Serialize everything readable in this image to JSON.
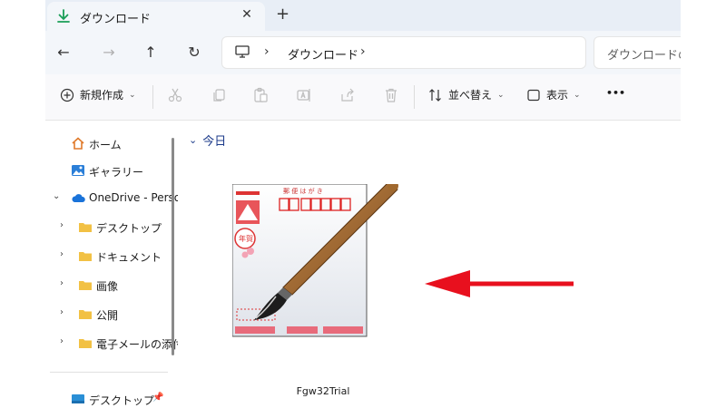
{
  "tab": {
    "title": "ダウンロード",
    "close": "✕",
    "new_tab": "+"
  },
  "nav": {
    "back": "←",
    "forward": "→",
    "up": "↑",
    "refresh": "↻"
  },
  "address": {
    "sep1": "›",
    "crumb": "ダウンロード",
    "sep2": "›"
  },
  "search": {
    "placeholder": "ダウンロードの検"
  },
  "toolbar": {
    "new_label": "新規作成",
    "sort_label": "並べ替え",
    "view_label": "表示",
    "more": "•••"
  },
  "sidebar": {
    "items": [
      {
        "label": "ホーム"
      },
      {
        "label": "ギャラリー"
      },
      {
        "label": "OneDrive - Perso"
      },
      {
        "label": "デスクトップ"
      },
      {
        "label": "ドキュメント"
      },
      {
        "label": "画像"
      },
      {
        "label": "公開"
      },
      {
        "label": "電子メールの添付"
      },
      {
        "label": "デスクトップ"
      }
    ]
  },
  "content": {
    "group_label": "今日",
    "file": {
      "name": "Fgw32Trial"
    }
  },
  "colors": {
    "accent": "#0067c0",
    "folder": "#f2c144",
    "annotation_arrow": "#e8101e"
  }
}
